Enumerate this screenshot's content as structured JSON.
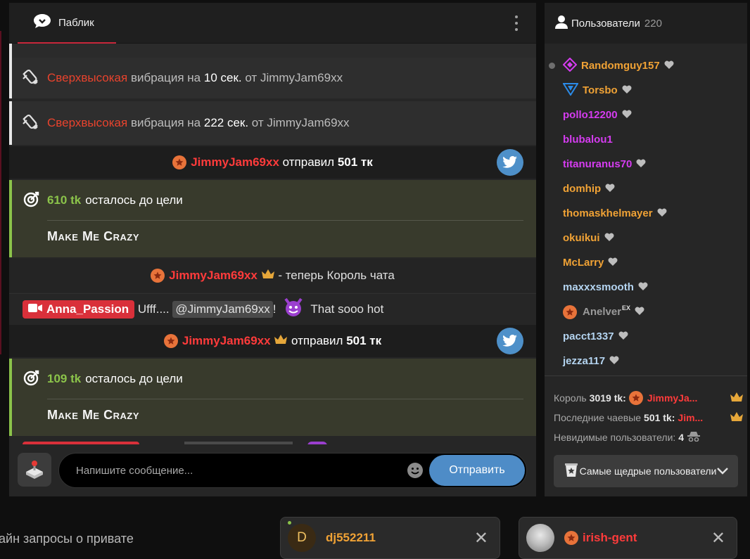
{
  "chat": {
    "tab_label": "Паблик",
    "messages": {
      "vib1": {
        "level": "Сверхвысокая",
        "mid1": "вибрация на",
        "duration": "10 сек.",
        "from": "от",
        "user": "JimmyJam69xx"
      },
      "vib2": {
        "level": "Сверхвысокая",
        "mid1": "вибрация на",
        "duration": "222 сек.",
        "from": "от",
        "user": "JimmyJam69xx"
      },
      "tip1": {
        "user": "JimmyJam69xx",
        "action": "отправил",
        "amount": "501 тк"
      },
      "goal1": {
        "remaining": "610 tk",
        "text": "осталось до цели",
        "goal": "Make Me Crazy"
      },
      "king": {
        "user": "JimmyJam69xx",
        "text": "- теперь Король чата"
      },
      "model": {
        "user": "Anna_Passion",
        "prefix": "Ufff....",
        "mention": "@JimmyJam69xx",
        "bang": "!",
        "suffix": "That sooo hot"
      },
      "tip2": {
        "user": "JimmyJam69xx",
        "action": "отправил",
        "amount": "501 тк"
      },
      "goal2": {
        "remaining": "109 tk",
        "text": "осталось до цели",
        "goal": "Make Me Crazy"
      }
    },
    "input_placeholder": "Напишите сообщение...",
    "send_label": "Отправить"
  },
  "users": {
    "title": "Пользователи",
    "count": "220",
    "list": [
      {
        "name": "Randomguy157",
        "color": "#f0a235"
      },
      {
        "name": "Torsbo",
        "color": "#f0a235"
      },
      {
        "name": "pollo12200",
        "color": "#d53cf0"
      },
      {
        "name": "blubalou1",
        "color": "#d53cf0"
      },
      {
        "name": "titanuranus70",
        "color": "#d53cf0"
      },
      {
        "name": "domhip",
        "color": "#f0a235"
      },
      {
        "name": "thomaskhelmayer",
        "color": "#f0a235"
      },
      {
        "name": "okuikui",
        "color": "#f0a235"
      },
      {
        "name": "McLarry",
        "color": "#f0a235"
      },
      {
        "name": "maxxxsmooth",
        "color": "#b4d4f0"
      },
      {
        "name": "Anelver",
        "sup": "EX",
        "color": "#9a9a9a"
      },
      {
        "name": "pacct1337",
        "color": "#b4d4f0"
      },
      {
        "name": "jezza117",
        "color": "#b4d4f0"
      }
    ],
    "stats": {
      "king_label": "Король",
      "king_amount": "3019 tk:",
      "king_user": "JimmyJa...",
      "last_tip_label": "Последние чаевые",
      "last_tip_amount": "501 tk:",
      "last_tip_user": "Jim...",
      "invisible_label": "Невидимые пользователи:",
      "invisible_count": "4"
    },
    "generous_label": "Самые щедрые пользователи"
  },
  "bottom": {
    "private_text": "айн запросы о привате",
    "chip1": {
      "initial": "D",
      "name": "dj552211",
      "close": "✕"
    },
    "chip2": {
      "name": "irish-gent",
      "close": "✕"
    }
  },
  "colors": {
    "accent_red": "#c8273a",
    "goal_green": "#8bc34a",
    "send_blue": "#4e8cc7",
    "twitter_blue": "#4e90c9"
  }
}
